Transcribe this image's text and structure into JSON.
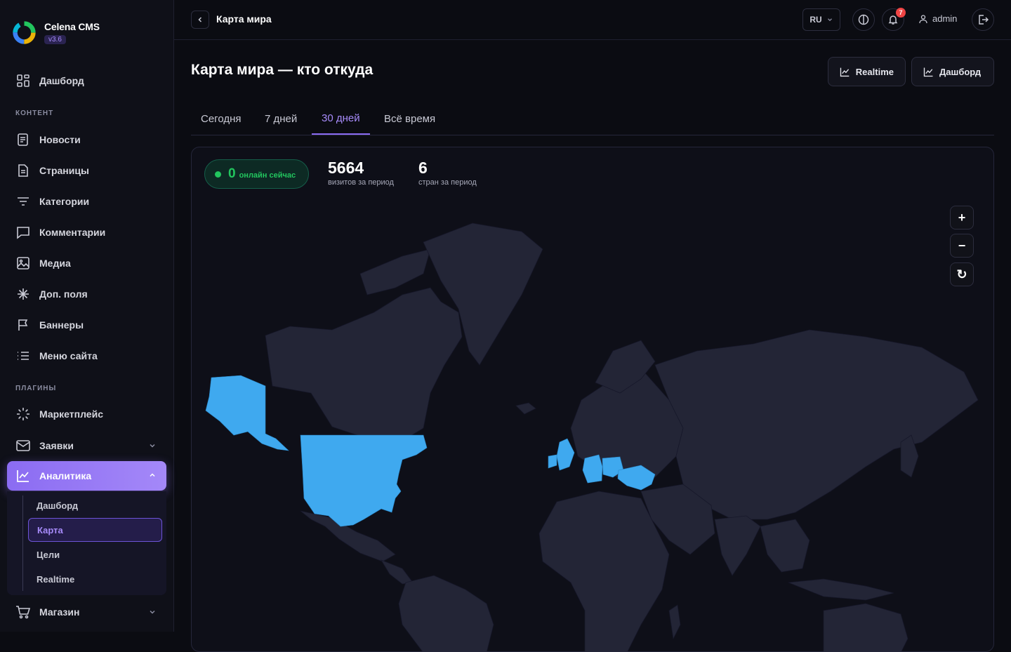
{
  "brand": {
    "name": "Celena CMS",
    "version": "v3.6"
  },
  "sidebar": {
    "dashboard": "Дашборд",
    "section_content": "КОНТЕНТ",
    "content_items": [
      {
        "label": "Новости",
        "icon": "news-icon"
      },
      {
        "label": "Страницы",
        "icon": "pages-icon"
      },
      {
        "label": "Категории",
        "icon": "filter-icon"
      },
      {
        "label": "Комментарии",
        "icon": "comment-icon"
      },
      {
        "label": "Медиа",
        "icon": "image-icon"
      },
      {
        "label": "Доп. поля",
        "icon": "asterisk-icon"
      },
      {
        "label": "Баннеры",
        "icon": "flag-icon"
      },
      {
        "label": "Меню сайта",
        "icon": "list-icon"
      }
    ],
    "section_plugins": "ПЛАГИНЫ",
    "plugin_items": [
      {
        "label": "Маркетплейс",
        "icon": "spinner-icon"
      },
      {
        "label": "Заявки",
        "icon": "mail-icon"
      }
    ],
    "active": {
      "label": "Аналитика",
      "icon": "chart-line-icon"
    },
    "sub_items": [
      "Дашборд",
      "Карта",
      "Цели",
      "Realtime"
    ],
    "shop": "Магазин"
  },
  "topbar": {
    "title": "Карта мира",
    "lang": "RU",
    "notifications": "7",
    "user": "admin"
  },
  "header": {
    "title": "Карта мира — кто откуда",
    "btn_realtime": "Realtime",
    "btn_dashboard": "Дашборд"
  },
  "tabs": [
    "Сегодня",
    "7 дней",
    "30 дней",
    "Всё время"
  ],
  "active_tab": "30 дней",
  "stats": {
    "online_value": "0",
    "online_label": "онлайн сейчас",
    "visits_value": "5664",
    "visits_label": "визитов за период",
    "countries_value": "6",
    "countries_label": "стран за период"
  },
  "map": {
    "zoom_in": "+",
    "zoom_out": "−",
    "reset": "↻",
    "highlight_color": "#3fa9ef",
    "land_color": "#232536",
    "water_color": "#0e0f18",
    "highlighted_countries": [
      "United States",
      "United Kingdom",
      "Ireland",
      "Germany",
      "Poland",
      "Ukraine"
    ]
  }
}
